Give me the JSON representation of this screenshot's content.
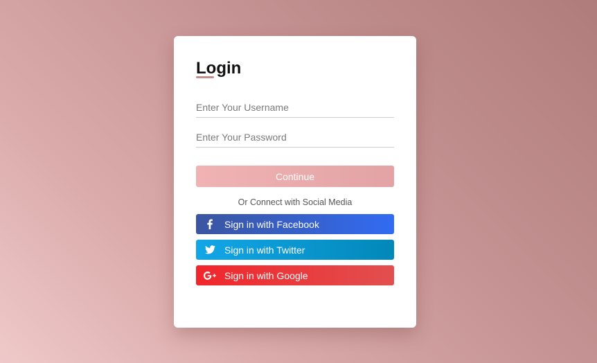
{
  "login": {
    "title": "Login",
    "username_placeholder": "Enter Your Username",
    "password_placeholder": "Enter Your Password",
    "continue_label": "Continue",
    "social_text": "Or Connect with Social Media",
    "facebook_label": "Sign in with Facebook",
    "twitter_label": "Sign in with Twitter",
    "google_label": "Sign in with Google"
  },
  "colors": {
    "accent": "#c98c8c",
    "continue_start": "#f0b3b3",
    "facebook": "#3b55a0",
    "twitter": "#12a6e8",
    "google": "#f0262b"
  },
  "icons": {
    "facebook": "facebook-icon",
    "twitter": "twitter-icon",
    "google": "google-plus-icon"
  }
}
